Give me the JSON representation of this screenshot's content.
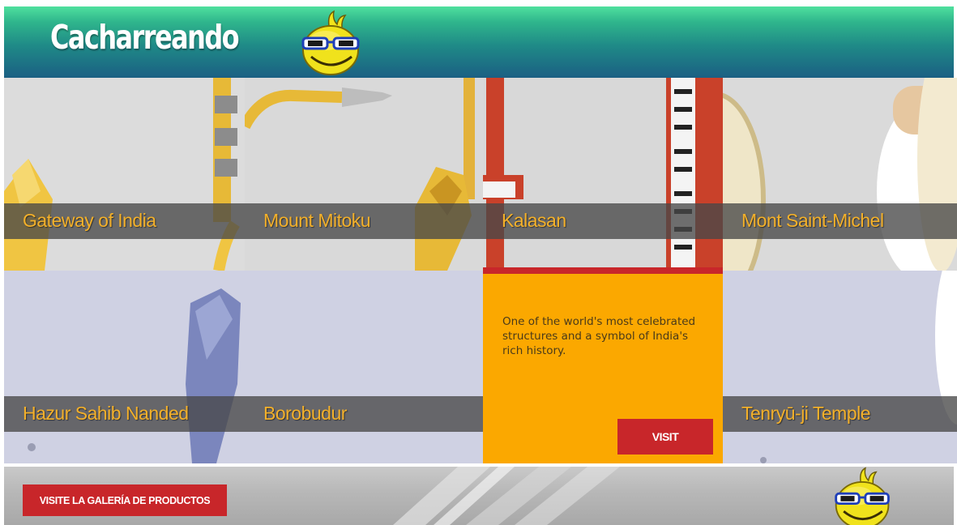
{
  "header": {
    "title": "Cacharreando",
    "logo_icon": "smiley-glasses-icon",
    "gradient_top": "#4fe09e",
    "gradient_bottom": "#1b5f83"
  },
  "tiles": [
    {
      "label": "Gateway of India"
    },
    {
      "label": "Mount Mitoku"
    },
    {
      "label": "Kalasan"
    },
    {
      "label": "Mont Saint-Michel"
    },
    {
      "label": "Hazur Sahib Nanded"
    },
    {
      "label": "Borobudur"
    },
    {
      "label": "Tenryū-ji Temple"
    }
  ],
  "active_tile": {
    "description": "One of the world's most celebrated structures and a symbol of India's rich history.",
    "button_label": "VISIT",
    "background_color": "#fba800",
    "accent_color": "#c8262a"
  },
  "footer": {
    "button_label": "VISITE LA GALERÍA DE PRODUCTOS",
    "logo_icon": "smiley-glasses-icon"
  },
  "colors": {
    "label_text": "#f3b02a",
    "label_bar": "#484848",
    "button": "#c8262a"
  }
}
